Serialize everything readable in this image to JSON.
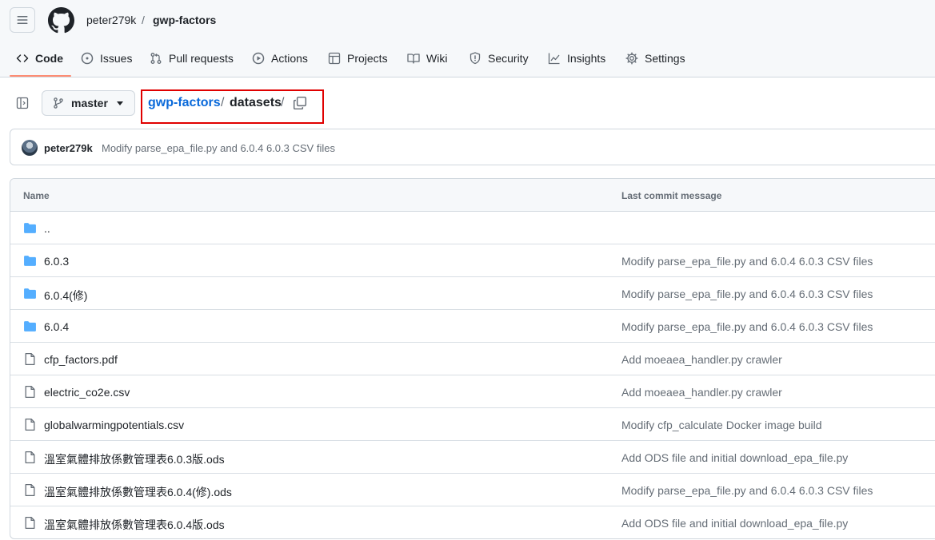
{
  "header": {
    "owner": "peter279k",
    "separator": "/",
    "repo": "gwp-factors",
    "menu_icon": "hamburger-icon",
    "logo_icon": "github-logo-icon"
  },
  "nav": {
    "tabs": [
      {
        "label": "Code",
        "icon": "code-icon",
        "selected": true
      },
      {
        "label": "Issues",
        "icon": "issue-icon"
      },
      {
        "label": "Pull requests",
        "icon": "pull-request-icon"
      },
      {
        "label": "Actions",
        "icon": "play-icon"
      },
      {
        "label": "Projects",
        "icon": "table-icon"
      },
      {
        "label": "Wiki",
        "icon": "book-icon"
      },
      {
        "label": "Security",
        "icon": "shield-icon"
      },
      {
        "label": "Insights",
        "icon": "graph-icon"
      },
      {
        "label": "Settings",
        "icon": "gear-icon"
      }
    ],
    "accent": "#fd8c73"
  },
  "toolbar": {
    "branch": "master",
    "path": {
      "repo_link": "gwp-factors",
      "separator": "/",
      "current": "datasets",
      "trailing_separator": "/"
    },
    "highlight_color": "#e00000"
  },
  "commit": {
    "author": "peter279k",
    "message": "Modify parse_epa_file.py and 6.0.4 6.0.3 CSV files"
  },
  "table": {
    "headers": {
      "name": "Name",
      "message": "Last commit message"
    },
    "rows": [
      {
        "type": "folder",
        "name": "..",
        "message": ""
      },
      {
        "type": "folder",
        "name": "6.0.3",
        "message": "Modify parse_epa_file.py and 6.0.4 6.0.3 CSV files"
      },
      {
        "type": "folder",
        "name": "6.0.4(修)",
        "message": "Modify parse_epa_file.py and 6.0.4 6.0.3 CSV files"
      },
      {
        "type": "folder",
        "name": "6.0.4",
        "message": "Modify parse_epa_file.py and 6.0.4 6.0.3 CSV files"
      },
      {
        "type": "file",
        "name": "cfp_factors.pdf",
        "message": "Add moeaea_handler.py crawler"
      },
      {
        "type": "file",
        "name": "electric_co2e.csv",
        "message": "Add moeaea_handler.py crawler"
      },
      {
        "type": "file",
        "name": "globalwarmingpotentials.csv",
        "message": "Modify cfp_calculate Docker image build"
      },
      {
        "type": "file",
        "name": "溫室氣體排放係數管理表6.0.3版.ods",
        "message": "Add ODS file and initial download_epa_file.py"
      },
      {
        "type": "file",
        "name": "溫室氣體排放係數管理表6.0.4(修).ods",
        "message": "Modify parse_epa_file.py and 6.0.4 6.0.3 CSV files"
      },
      {
        "type": "file",
        "name": "溫室氣體排放係數管理表6.0.4版.ods",
        "message": "Add ODS file and initial download_epa_file.py"
      }
    ],
    "folder_color": "#54aeff"
  }
}
